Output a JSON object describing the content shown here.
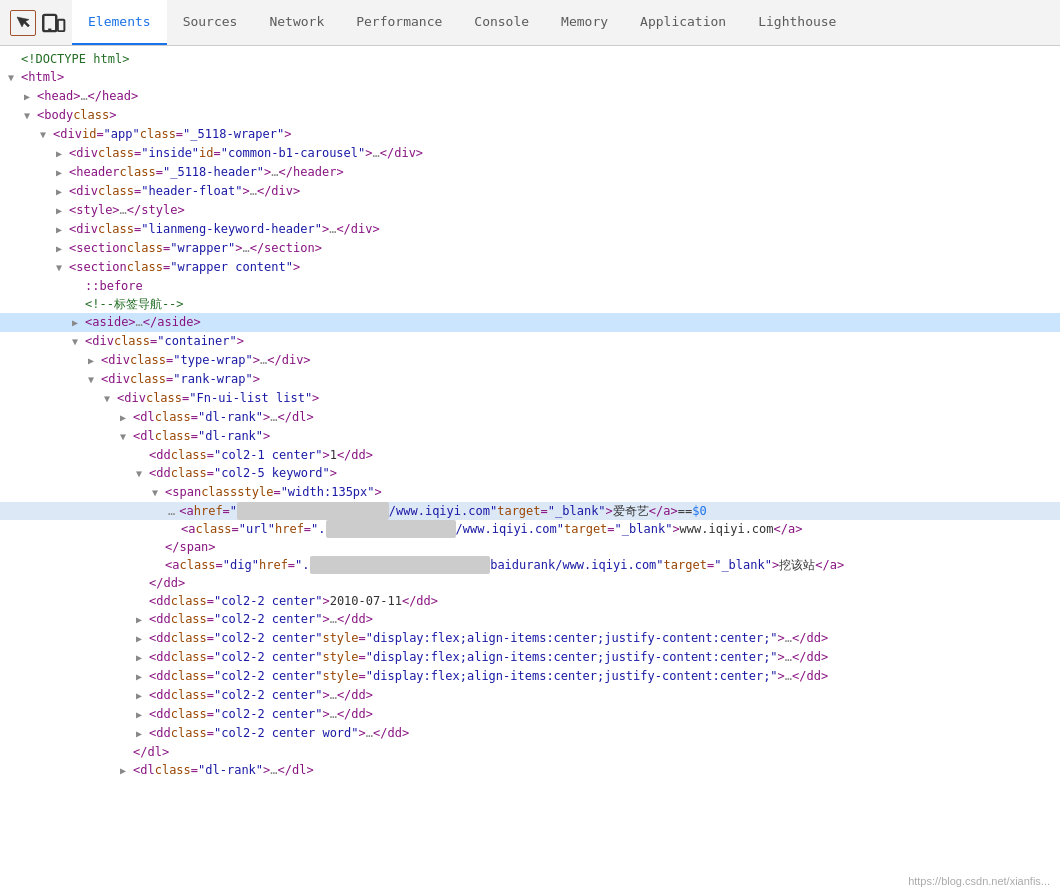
{
  "toolbar": {
    "tabs": [
      {
        "id": "elements",
        "label": "Elements",
        "active": true
      },
      {
        "id": "sources",
        "label": "Sources",
        "active": false
      },
      {
        "id": "network",
        "label": "Network",
        "active": false
      },
      {
        "id": "performance",
        "label": "Performance",
        "active": false
      },
      {
        "id": "console",
        "label": "Console",
        "active": false
      },
      {
        "id": "memory",
        "label": "Memory",
        "active": false
      },
      {
        "id": "application",
        "label": "Application",
        "active": false
      },
      {
        "id": "lighthouse",
        "label": "Lighthouse",
        "active": false
      }
    ]
  },
  "watermark": "https://blog.csdn.net/xianfis...",
  "lines": [
    {
      "id": 1,
      "indent": 0,
      "arrow": "leaf",
      "content": "doctype",
      "text": "<!DOCTYPE html>"
    },
    {
      "id": 2,
      "indent": 0,
      "arrow": "open",
      "content": "tag",
      "text": "<html>"
    },
    {
      "id": 3,
      "indent": 1,
      "arrow": "closed",
      "content": "tag",
      "text": "<head>…</head>"
    },
    {
      "id": 4,
      "indent": 1,
      "arrow": "open",
      "content": "tag",
      "text": "<body class>"
    },
    {
      "id": 5,
      "indent": 2,
      "arrow": "open",
      "content": "mixed",
      "text": "<div id=\"app\" class=\"_5118-wraper\">"
    },
    {
      "id": 6,
      "indent": 3,
      "arrow": "closed",
      "content": "mixed",
      "text": "<div class=\"inside\" id=\"common-b1-carousel\">…</div>"
    },
    {
      "id": 7,
      "indent": 3,
      "arrow": "closed",
      "content": "mixed",
      "text": "<header class=\"_5118-header\">…</header>"
    },
    {
      "id": 8,
      "indent": 3,
      "arrow": "closed",
      "content": "mixed",
      "text": "<div class=\"header-float\">…</div>"
    },
    {
      "id": 9,
      "indent": 3,
      "arrow": "closed",
      "content": "mixed",
      "text": "<style>…</style>"
    },
    {
      "id": 10,
      "indent": 3,
      "arrow": "closed",
      "content": "mixed",
      "text": "<div class=\"lianmeng-keyword-header\">…</div>"
    },
    {
      "id": 11,
      "indent": 3,
      "arrow": "closed",
      "content": "mixed",
      "text": "<section class=\"wrapper\">…</section>"
    },
    {
      "id": 12,
      "indent": 3,
      "arrow": "open",
      "content": "mixed",
      "text": "<section class=\"wrapper content\">"
    },
    {
      "id": 13,
      "indent": 4,
      "arrow": "leaf",
      "content": "pseudo",
      "text": "::before"
    },
    {
      "id": 14,
      "indent": 4,
      "arrow": "leaf",
      "content": "comment",
      "text": "<!--标签导航-->"
    },
    {
      "id": 15,
      "indent": 4,
      "arrow": "closed",
      "content": "mixed",
      "text": "<aside>…</aside>",
      "selected": true
    },
    {
      "id": 16,
      "indent": 4,
      "arrow": "open",
      "content": "mixed",
      "text": "<div class=\"container\">"
    },
    {
      "id": 17,
      "indent": 5,
      "arrow": "closed",
      "content": "mixed",
      "text": "<div class=\"type-wrap\">…</div>"
    },
    {
      "id": 18,
      "indent": 5,
      "arrow": "open",
      "content": "mixed",
      "text": "<div class=\"rank-wrap\">"
    },
    {
      "id": 19,
      "indent": 6,
      "arrow": "open",
      "content": "mixed",
      "text": "<div class=\"Fn-ui-list list\">"
    },
    {
      "id": 20,
      "indent": 7,
      "arrow": "closed",
      "content": "mixed",
      "text": "<dl class=\"dl-rank\">…</dl>"
    },
    {
      "id": 21,
      "indent": 7,
      "arrow": "open",
      "content": "mixed",
      "text": "<dl class=\"dl-rank\">"
    },
    {
      "id": 22,
      "indent": 8,
      "arrow": "leaf",
      "content": "mixed",
      "text": "<dd class=\"col2-1 center\">1</dd>"
    },
    {
      "id": 23,
      "indent": 8,
      "arrow": "open",
      "content": "mixed",
      "text": "<dd class=\"col2-5 keyword\">"
    },
    {
      "id": 24,
      "indent": 9,
      "arrow": "open",
      "content": "mixed",
      "text": "<span class style=\"width:135px\">"
    },
    {
      "id": 25,
      "indent": 10,
      "arrow": "leaf",
      "content": "anchor-selected",
      "text": "<a href=\"",
      "url": "www.iqiyi.com",
      "url2": " target=\"_blank\">爱奇艺</a> == $0",
      "highlighted": true
    },
    {
      "id": 26,
      "indent": 10,
      "arrow": "leaf",
      "content": "anchor2",
      "text": "<a class=\"url\" href=\".",
      "url2": "www.iqiyi.com",
      "url3": "\" target=\"_blank\">www.iqiyi.com</a>"
    },
    {
      "id": 27,
      "indent": 9,
      "arrow": "leaf",
      "content": "tag",
      "text": "</span>"
    },
    {
      "id": 28,
      "indent": 9,
      "arrow": "leaf",
      "content": "anchor3",
      "text": "<a class=\"dig\" href=\".",
      "url4": "baidurank/www.iqiyi.com",
      "url5": "\" target=\"_blank\">挖该站</a>"
    },
    {
      "id": 29,
      "indent": 8,
      "arrow": "leaf",
      "content": "tag",
      "text": "</dd>"
    },
    {
      "id": 30,
      "indent": 8,
      "arrow": "leaf",
      "content": "mixed",
      "text": "<dd class=\"col2-2 center\">2010-07-11</dd>"
    },
    {
      "id": 31,
      "indent": 8,
      "arrow": "closed",
      "content": "mixed",
      "text": "<dd class=\"col2-2 center\">…</dd>"
    },
    {
      "id": 32,
      "indent": 8,
      "arrow": "closed",
      "content": "mixed",
      "text": "<dd class=\"col2-2 center\" style=\"display:flex;align-items:center;justify-content:center;\">…</dd>"
    },
    {
      "id": 33,
      "indent": 8,
      "arrow": "closed",
      "content": "mixed",
      "text": "<dd class=\"col2-2 center\" style=\"display:flex;align-items:center;justify-content:center;\">…</dd>"
    },
    {
      "id": 34,
      "indent": 8,
      "arrow": "closed",
      "content": "mixed",
      "text": "<dd class=\"col2-2 center\" style=\"display:flex;align-items:center;justify-content:center;\">…</dd>"
    },
    {
      "id": 35,
      "indent": 8,
      "arrow": "closed",
      "content": "mixed",
      "text": "<dd class=\"col2-2 center\">…</dd>"
    },
    {
      "id": 36,
      "indent": 8,
      "arrow": "closed",
      "content": "mixed",
      "text": "<dd class=\"col2-2 center\">…</dd>"
    },
    {
      "id": 37,
      "indent": 8,
      "arrow": "closed",
      "content": "mixed",
      "text": "<dd class=\"col2-2 center word\">…</dd>"
    },
    {
      "id": 38,
      "indent": 7,
      "arrow": "leaf",
      "content": "tag",
      "text": "</dl>"
    },
    {
      "id": 39,
      "indent": 7,
      "arrow": "closed",
      "content": "mixed",
      "text": "<dl class=\"dl-rank\">…</dl>"
    }
  ]
}
